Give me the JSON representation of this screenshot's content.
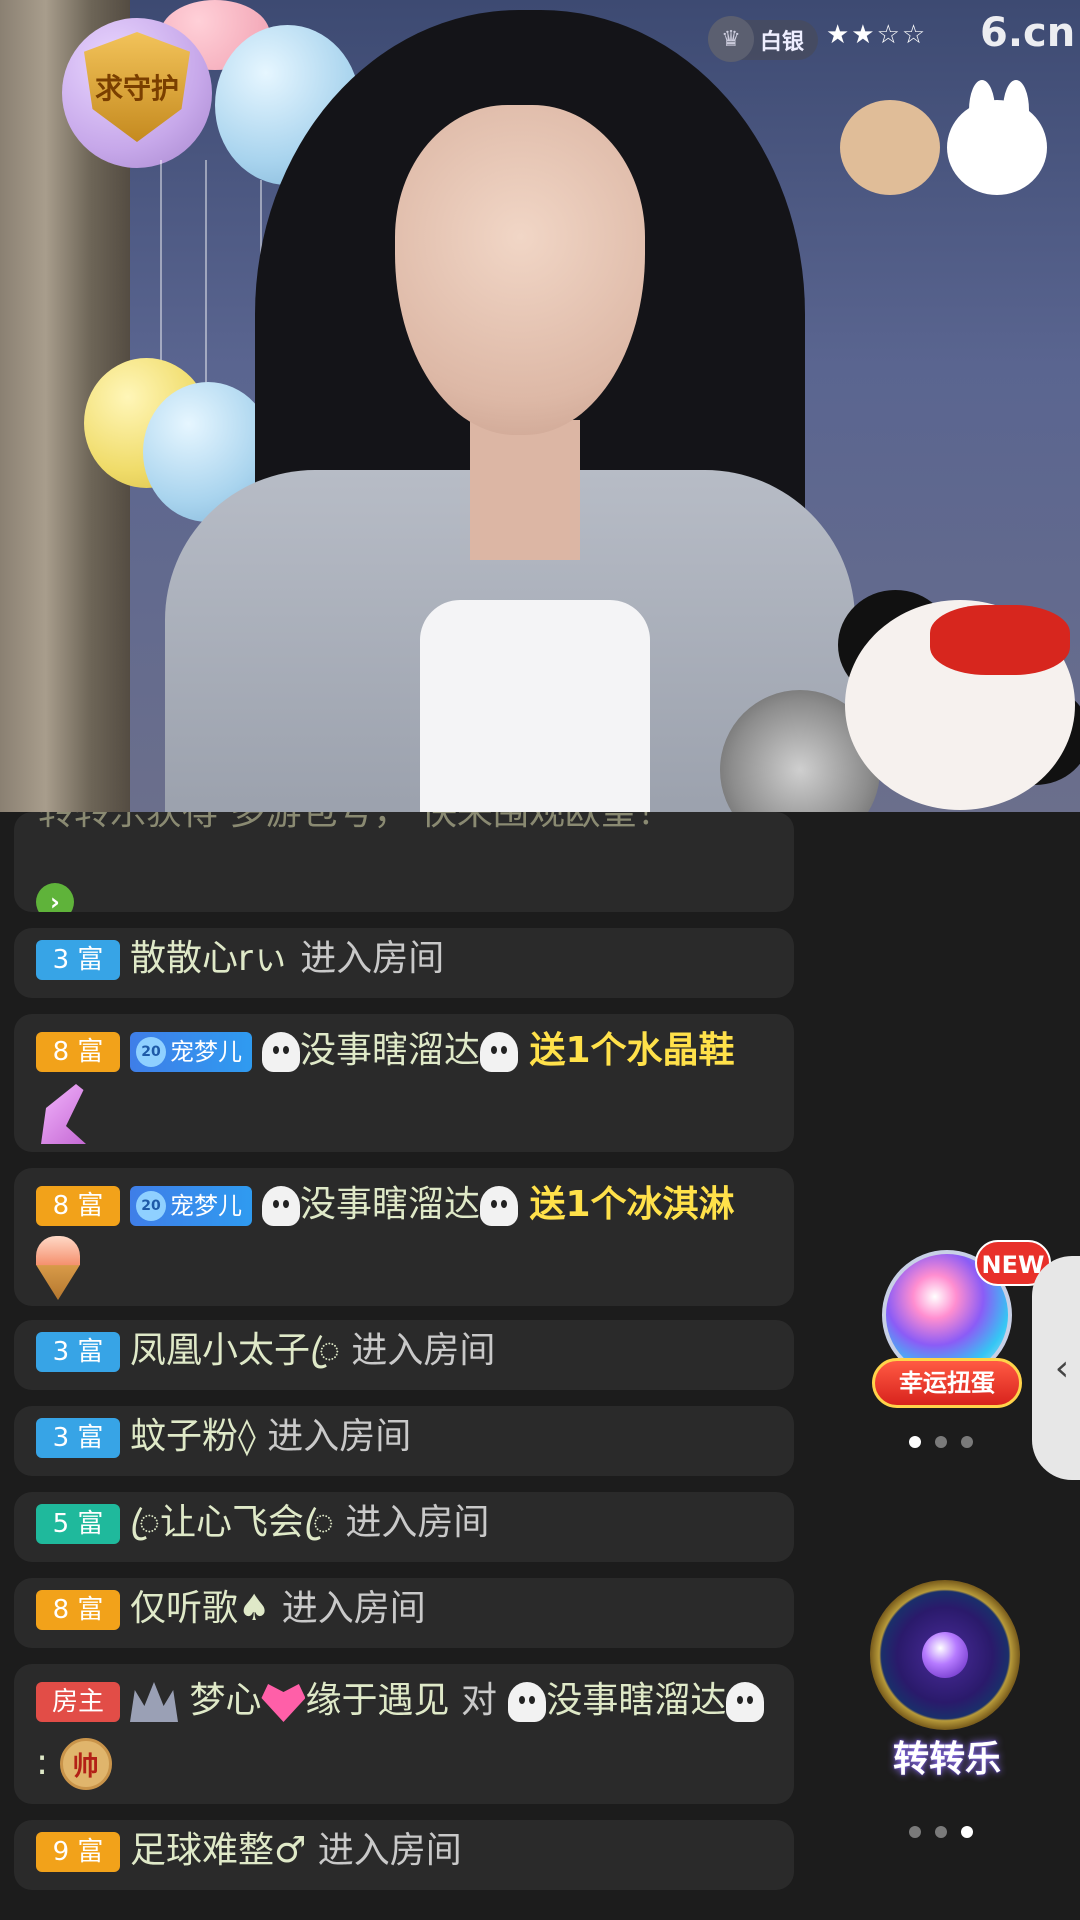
{
  "video": {
    "guard_badge": "求守护",
    "rank_label": "白银",
    "rank_stars": "★★☆☆",
    "site_logo": "6.cn"
  },
  "chat": {
    "cut_text": "转转乐获得 多游包号， 快来围观欧皇！",
    "messages": [
      {
        "level": "3 富",
        "name": "散散心rぃ",
        "action": "进入房间"
      },
      {
        "level": "8 富",
        "pet_badge": "宠梦儿",
        "pet_level": "20",
        "name": "没事瞎溜达",
        "gift": "送1个水晶鞋"
      },
      {
        "level": "8 富",
        "pet_badge": "宠梦儿",
        "pet_level": "20",
        "name": "没事瞎溜达",
        "gift": "送1个冰淇淋"
      },
      {
        "level": "3 富",
        "name": "凤凰小太子ꦿ",
        "action": "进入房间"
      },
      {
        "level": "3 富",
        "name": "蚊子粉◊",
        "action": "进入房间"
      },
      {
        "level": "5 富",
        "name": "ꦿ让心飞会ꦿ",
        "action": "进入房间"
      },
      {
        "level": "8 富",
        "name": "仅听歌♠",
        "action": "进入房间"
      },
      {
        "level": "房主",
        "name": "梦心",
        "name2": "缘于遇见",
        "action": "对",
        "target": "没事瞎溜达",
        "suffix": ":",
        "chess": "帅"
      },
      {
        "level": "9 富",
        "name": "足球难整♂",
        "action": "进入房间"
      }
    ]
  },
  "widgets": {
    "new_label": "NEW",
    "gacha_label": "幸运扭蛋",
    "wheel_label": "转转乐",
    "handle_icon": "‹"
  },
  "colors": {
    "level_3": "#37a4e6",
    "level_5": "#1fb99c",
    "level_8": "#f2a21a",
    "host": "#e24d47",
    "gift_text": "#ffe14a"
  }
}
